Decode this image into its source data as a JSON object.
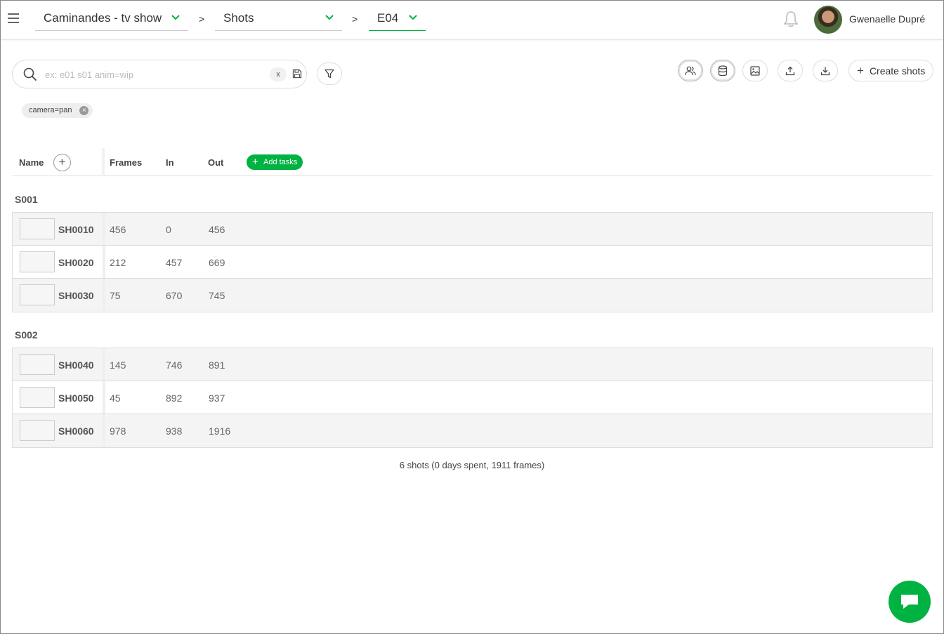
{
  "breadcrumb": {
    "production": "Caminandes - tv show",
    "section": "Shots",
    "episode": "E04",
    "separator": ">"
  },
  "user": {
    "name": "Gwenaelle Dupré"
  },
  "search": {
    "placeholder": "ex: e01 s01 anim=wip",
    "value": "",
    "clear_label": "x"
  },
  "filters": [
    {
      "label": "camera=pan"
    }
  ],
  "toolbar": {
    "create_label": "Create shots"
  },
  "table": {
    "headers": {
      "name": "Name",
      "frames": "Frames",
      "in": "In",
      "out": "Out",
      "add_tasks": "Add tasks",
      "add_column": "+"
    },
    "sequences": [
      {
        "name": "S001",
        "shots": [
          {
            "name": "SH0010",
            "frames": "456",
            "in": "0",
            "out": "456"
          },
          {
            "name": "SH0020",
            "frames": "212",
            "in": "457",
            "out": "669"
          },
          {
            "name": "SH0030",
            "frames": "75",
            "in": "670",
            "out": "745"
          }
        ]
      },
      {
        "name": "S002",
        "shots": [
          {
            "name": "SH0040",
            "frames": "145",
            "in": "746",
            "out": "891"
          },
          {
            "name": "SH0050",
            "frames": "45",
            "in": "892",
            "out": "937"
          },
          {
            "name": "SH0060",
            "frames": "978",
            "in": "938",
            "out": "1916"
          }
        ]
      }
    ]
  },
  "stats": "6 shots (0 days spent, 1911 frames)",
  "colors": {
    "accent": "#00b242"
  }
}
